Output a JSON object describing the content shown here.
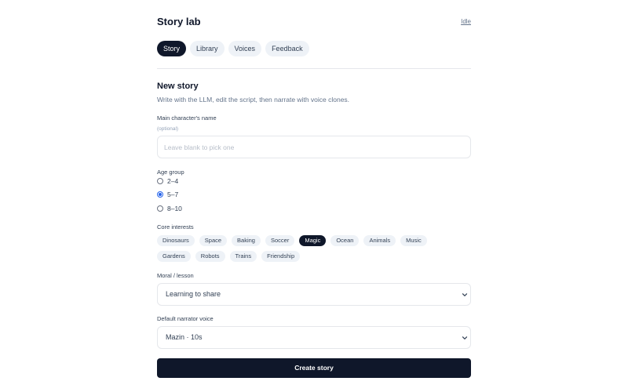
{
  "header": {
    "title": "Story lab",
    "status": "Idle"
  },
  "tabs": [
    {
      "label": "Story",
      "active": true
    },
    {
      "label": "Library",
      "active": false
    },
    {
      "label": "Voices",
      "active": false
    },
    {
      "label": "Feedback",
      "active": false
    }
  ],
  "section": {
    "title": "New story",
    "subtitle": "Write with the LLM, edit the script, then narrate with voice clones."
  },
  "character_name": {
    "label": "Main character's name",
    "hint": "(optional)",
    "value": "",
    "placeholder": "Leave blank to pick one"
  },
  "age_group": {
    "label": "Age group",
    "options": [
      {
        "label": "2–4",
        "checked": false
      },
      {
        "label": "5–7",
        "checked": true
      },
      {
        "label": "8–10",
        "checked": false
      }
    ]
  },
  "interests": {
    "label": "Core interests",
    "row1": [
      {
        "label": "Dinosaurs",
        "selected": false
      },
      {
        "label": "Space",
        "selected": false
      },
      {
        "label": "Baking",
        "selected": false
      },
      {
        "label": "Soccer",
        "selected": false
      },
      {
        "label": "Magic",
        "selected": true
      },
      {
        "label": "Ocean",
        "selected": false
      },
      {
        "label": "Animals",
        "selected": false
      },
      {
        "label": "Music",
        "selected": false
      }
    ],
    "row2": [
      {
        "label": "Gardens",
        "selected": false
      },
      {
        "label": "Robots",
        "selected": false
      },
      {
        "label": "Trains",
        "selected": false
      },
      {
        "label": "Friendship",
        "selected": false
      }
    ]
  },
  "moral": {
    "label": "Moral / lesson",
    "value": "Learning to share"
  },
  "narrator": {
    "label": "Default narrator voice",
    "value": "Mazin · 10s"
  },
  "submit": {
    "label": "Create story"
  },
  "icons": {
    "select_chevron": "chevron-down-icon"
  },
  "colors": {
    "primary": "#0f172a",
    "chip_bg": "#eef2f7",
    "radio_accent": "#2563eb",
    "border": "#e5e7eb",
    "muted_text": "#64748b"
  }
}
